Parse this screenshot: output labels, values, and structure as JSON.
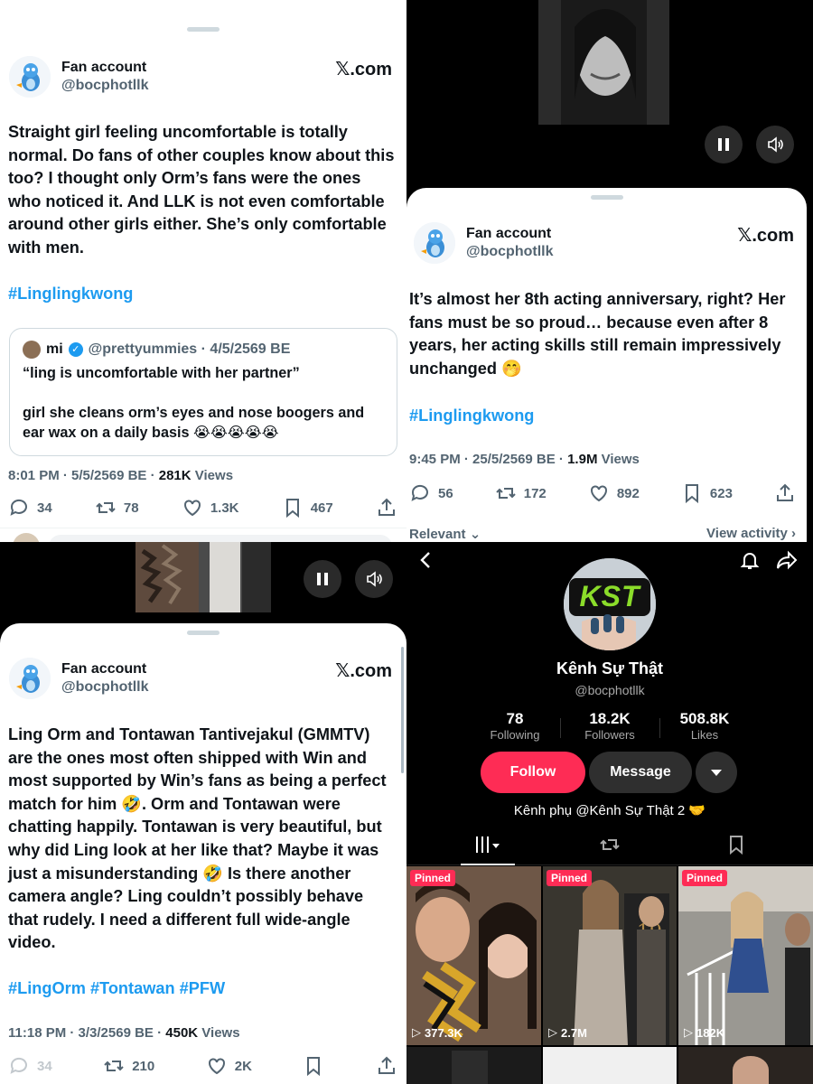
{
  "tweet1": {
    "display_name": "Fan account",
    "handle": "@bocphotllk",
    "source": "𝕏.com",
    "text": "Straight girl feeling uncomfortable is totally normal. Do fans of other couples know about this too? I thought only Orm’s fans were the ones who noticed it. And LLK is not even comfortable around other girls either. She’s only comfortable with men.",
    "hashtag": "#Linglingkwong",
    "quote": {
      "name": "mi",
      "handle_date": "@prettyummies · 4/5/2569 BE",
      "line1": "“ling is uncomfortable with her partner”",
      "line2": "girl she cleans orm’s eyes and nose boogers and ear wax on a daily basis 😭😭😭😭😭"
    },
    "timestamp": "8:01 PM · 5/5/2569 BE · ",
    "views_count": "281K",
    "views_label": " Views",
    "replies": "34",
    "retweets": "78",
    "likes": "1.3K",
    "bookmarks": "467"
  },
  "tweet2": {
    "display_name": "Fan account",
    "handle": "@bocphotllk",
    "source": "𝕏.com",
    "text": "It’s almost her 8th acting anniversary, right? Her fans must be so proud… because even after 8 years, her acting skills still remain impressively unchanged 🤭",
    "hashtag": "#Linglingkwong",
    "timestamp": "9:45 PM · 25/5/2569 BE · ",
    "views_count": "1.9M",
    "views_label": " Views",
    "replies": "56",
    "retweets": "172",
    "likes": "892",
    "bookmarks": "623",
    "sort_label": "Relevant",
    "view_activity": "View activity"
  },
  "tweet3": {
    "display_name": "Fan account",
    "handle": "@bocphotllk",
    "source": "𝕏.com",
    "text": "Ling Orm and Tontawan Tantivejakul (GMMTV) are the ones most often shipped with Win and most supported by Win’s fans as being a perfect match for him 🤣. Orm and Tontawan were chatting happily. Tontawan is very beautiful, but why did Ling look at her like that? Maybe it was just a misunderstanding 🤣 Is there another camera angle? Ling couldn’t possibly behave that rudely. I need a different full wide-angle video.",
    "hashtags": "#LingOrm #Tontawan #PFW",
    "timestamp": "11:18 PM · 3/3/2569 BE · ",
    "views_count": "450K",
    "views_label": " Views",
    "replies": "34",
    "retweets": "210",
    "likes": "2K"
  },
  "tiktok": {
    "avatar_text": "KST",
    "name": "Kênh Sự Thật",
    "handle": "@bocphotllk",
    "following_count": "78",
    "following_label": "Following",
    "followers_count": "18.2K",
    "followers_label": "Followers",
    "likes_count": "508.8K",
    "likes_label": "Likes",
    "follow_button": "Follow",
    "message_button": "Message",
    "bio": "Kênh phụ @Kênh Sự Thật 2 🤝",
    "videos": [
      {
        "badge": "Pinned",
        "views": "377.3K"
      },
      {
        "badge": "Pinned",
        "views": "2.7M"
      },
      {
        "badge": "Pinned",
        "views": "182K"
      }
    ],
    "accent": "#fe2c55"
  },
  "colors": {
    "link": "#1d9bf0",
    "muted": "#536471",
    "text": "#0f1419"
  }
}
